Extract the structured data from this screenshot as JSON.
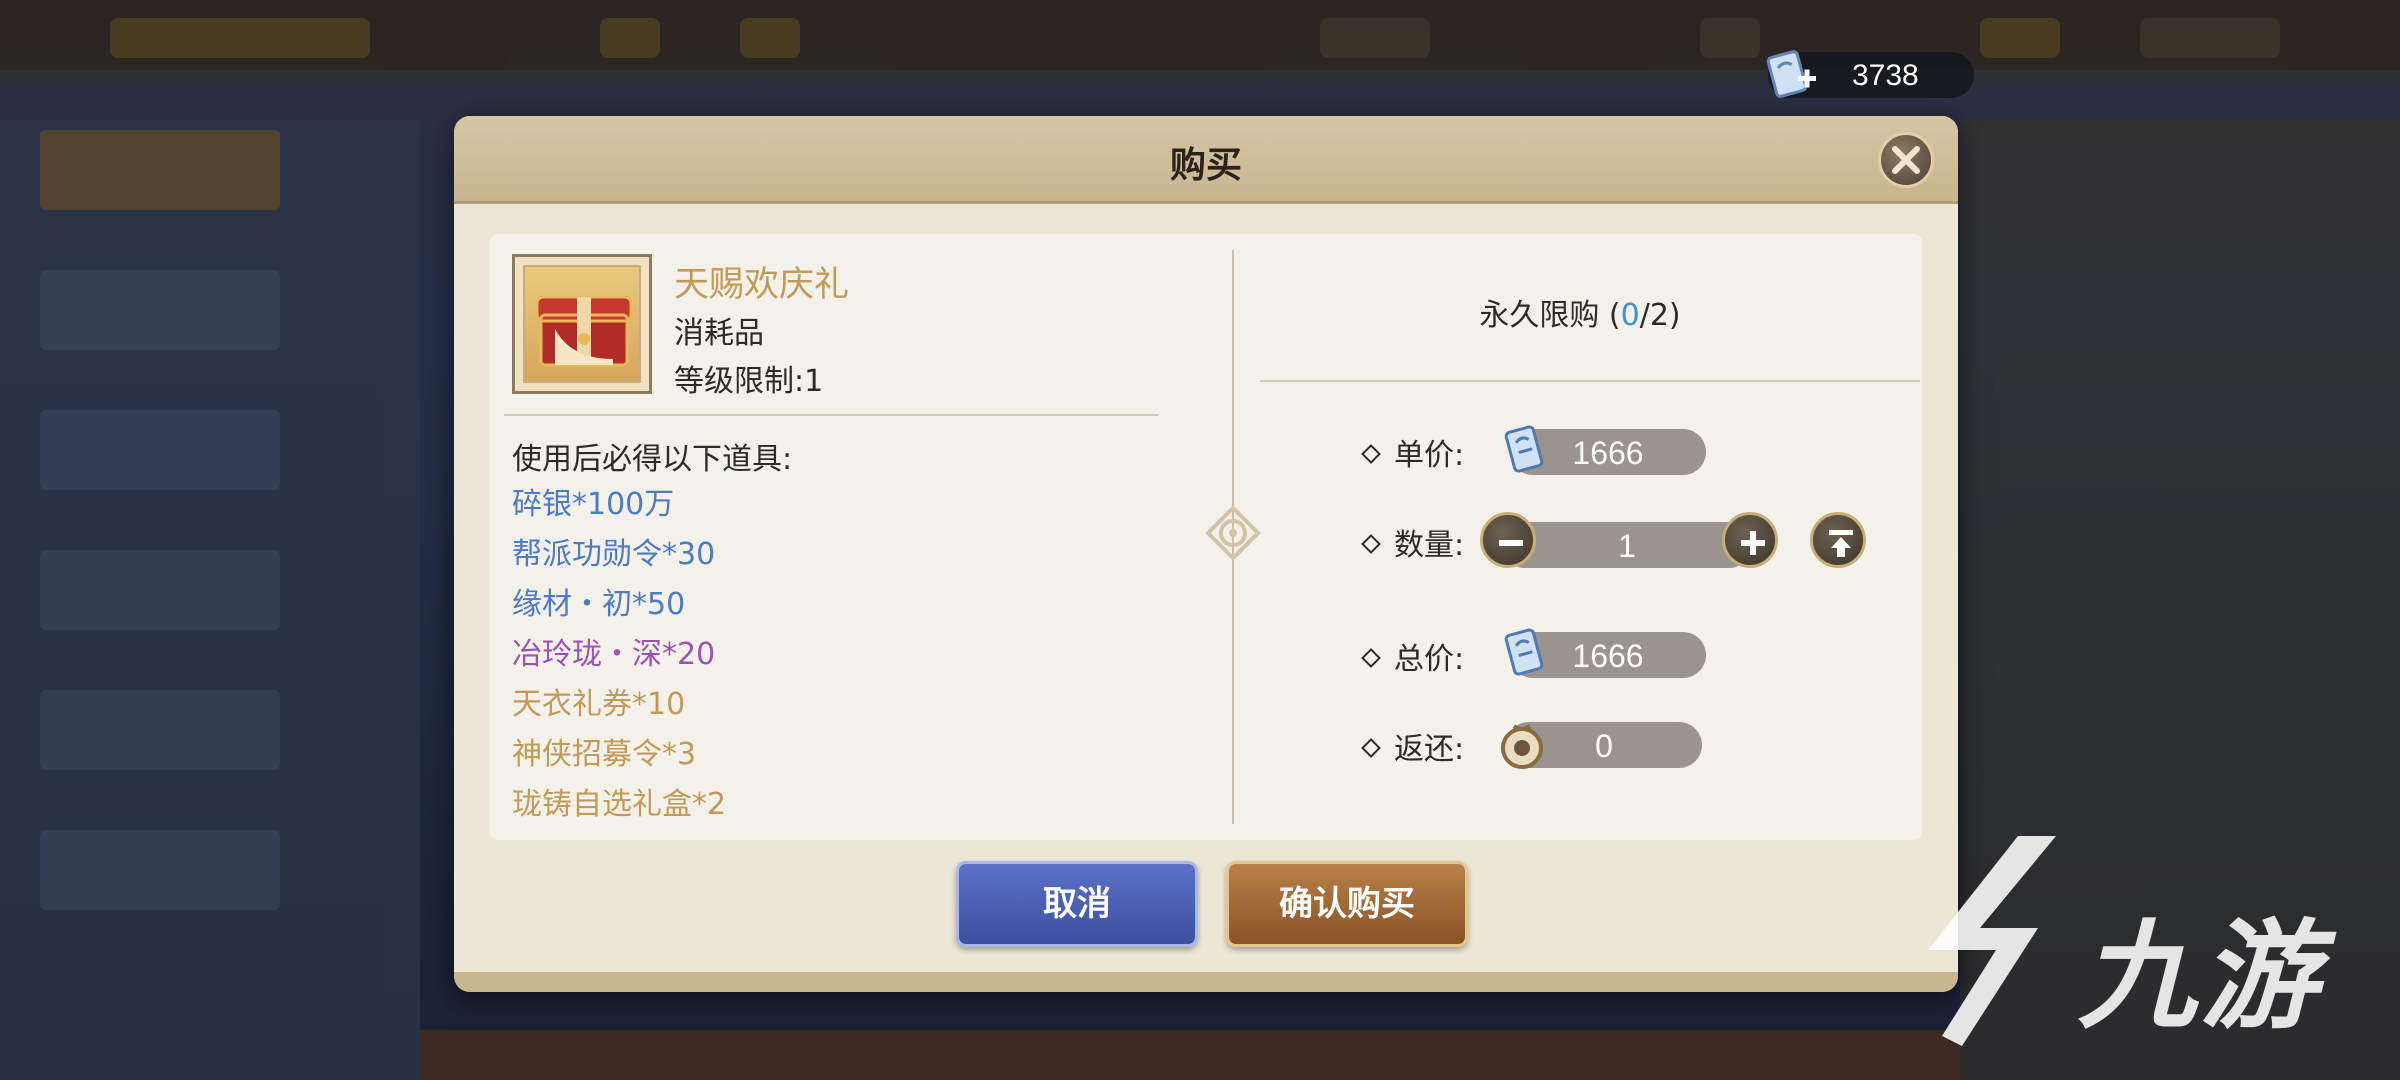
{
  "currency": {
    "amount": "3738",
    "icon": "ticket-plus-icon"
  },
  "dialog": {
    "title": "购买",
    "close_icon": "close-icon",
    "item": {
      "name": "天赐欢庆礼",
      "type": "消耗品",
      "level_limit": "等级限制:1",
      "icon": "gift-chest-icon"
    },
    "rewards_title": "使用后必得以下道具:",
    "rewards": [
      {
        "text": "碎银*100万",
        "color": "#4a7bc4"
      },
      {
        "text": "帮派功勋令*30",
        "color": "#4a7bc4"
      },
      {
        "text": "缘材・初*50",
        "color": "#4a7bc4"
      },
      {
        "text": "冶玲珑・深*20",
        "color": "#9b52b8"
      },
      {
        "text": "天衣礼券*10",
        "color": "#c29a57"
      },
      {
        "text": "神侠招募令*3",
        "color": "#c29a57"
      },
      {
        "text": "珑铸自选礼盒*2",
        "color": "#c29a57"
      }
    ],
    "limit": {
      "prefix": "永久限购 (",
      "current": "0",
      "suffix": "/2)"
    },
    "unit_price": {
      "label": "单价:",
      "value": "1666",
      "icon": "ticket-icon"
    },
    "quantity": {
      "label": "数量:",
      "value": "1",
      "minus_icon": "minus-icon",
      "plus_icon": "plus-icon",
      "max_icon": "max-icon"
    },
    "total_price": {
      "label": "总价:",
      "value": "1666",
      "icon": "ticket-icon"
    },
    "rebate": {
      "label": "返还:",
      "value": "0",
      "icon": "coin-icon"
    },
    "cancel_label": "取消",
    "confirm_label": "确认购买"
  },
  "watermark": {
    "text": "九游"
  },
  "colors": {
    "blue_value": "#3b8fe0",
    "gold_text": "#c29a57",
    "cancel_button": "#4a60b4",
    "confirm_button": "#a06a38"
  }
}
